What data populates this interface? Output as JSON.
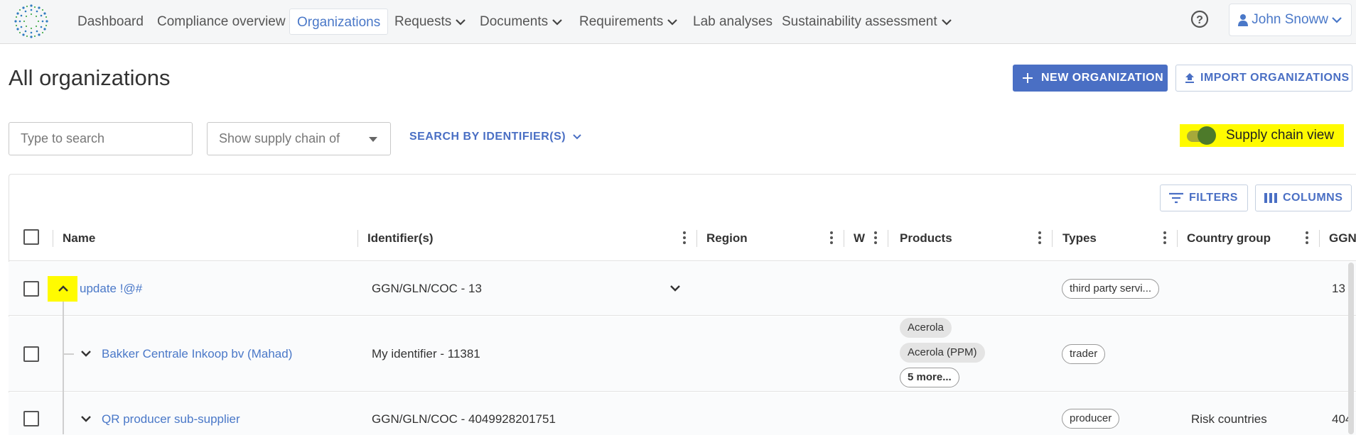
{
  "nav": {
    "items": [
      {
        "label": "Dashboard",
        "dropdown": false,
        "active": false
      },
      {
        "label": "Compliance overview",
        "dropdown": false,
        "active": false
      },
      {
        "label": "Organizations",
        "dropdown": false,
        "active": true
      },
      {
        "label": "Requests",
        "dropdown": true,
        "active": false
      },
      {
        "label": "Documents",
        "dropdown": true,
        "active": false
      },
      {
        "label": "Requirements",
        "dropdown": true,
        "active": false
      },
      {
        "label": "Lab analyses",
        "dropdown": false,
        "active": false
      },
      {
        "label": "Sustainability assessment",
        "dropdown": true,
        "active": false
      }
    ],
    "user": "John Snoww"
  },
  "page": {
    "title": "All organizations",
    "new_button": "NEW ORGANIZATION",
    "import_button": "IMPORT ORGANIZATIONS"
  },
  "toolbar": {
    "search_placeholder": "Type to search",
    "supply_chain_select": "Show supply chain of",
    "search_by_identifier": "SEARCH BY IDENTIFIER(S)",
    "supply_chain_view_label": "Supply chain view",
    "supply_chain_view_on": true,
    "filters_button": "FILTERS",
    "columns_button": "COLUMNS"
  },
  "table": {
    "columns": [
      "Name",
      "Identifier(s)",
      "Region",
      "W",
      "Products",
      "Types",
      "Country group",
      "GGN"
    ],
    "rows": [
      {
        "name": "update !@#",
        "identifier": "GGN/GLN/COC - 13",
        "products": [],
        "more": "",
        "types": [
          "third party servi..."
        ],
        "country_group": "",
        "ggn": "13"
      },
      {
        "name": "Bakker Centrale Inkoop bv (Mahad)",
        "identifier": "My identifier - 11381",
        "products": [
          "Acerola",
          "Acerola (PPM)"
        ],
        "more": "5 more...",
        "types": [
          "trader"
        ],
        "country_group": "",
        "ggn": ""
      },
      {
        "name": "QR producer sub-supplier",
        "identifier": "GGN/GLN/COC - 4049928201751",
        "products": [],
        "more": "",
        "types": [
          "producer"
        ],
        "country_group": "Risk countries",
        "ggn": "404"
      }
    ]
  },
  "colors": {
    "accent": "#4a78c8",
    "primary_button": "#4a6fc4",
    "highlight": "#fffb00",
    "toggle_on": "#4d7a2a"
  },
  "icons": [
    "logo-icon",
    "chevron-down-icon",
    "help-circle-icon",
    "user-icon",
    "plus-icon",
    "upload-icon",
    "filter-icon",
    "columns-icon",
    "kebab-icon",
    "chevron-up-icon"
  ]
}
